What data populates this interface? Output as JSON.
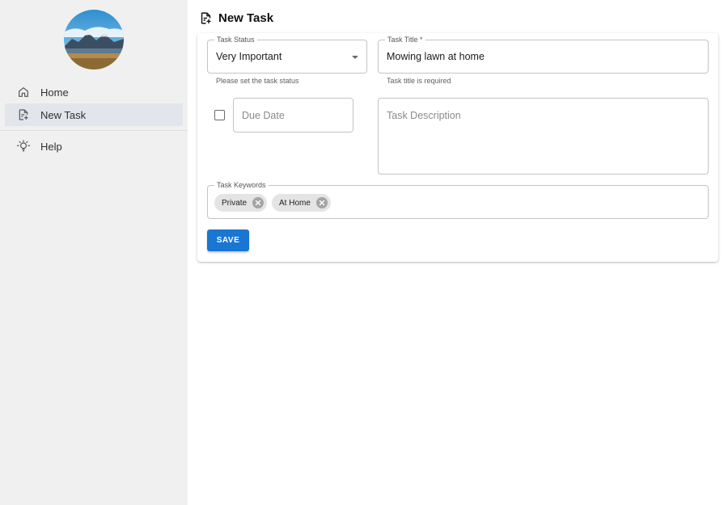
{
  "sidebar": {
    "items": [
      {
        "label": "Home",
        "icon": "home-icon"
      },
      {
        "label": "New Task",
        "icon": "note-add-icon",
        "active": true
      },
      {
        "label": "Help",
        "icon": "lightbulb-icon"
      }
    ]
  },
  "header": {
    "title": "New Task",
    "icon": "note-add-icon"
  },
  "form": {
    "status": {
      "label": "Task Status",
      "value": "Very Important",
      "helper": "Please set the task status"
    },
    "title": {
      "label": "Task Title *",
      "value": "Mowing lawn at home",
      "helper": "Task title is required"
    },
    "due_date": {
      "placeholder": "Due Date",
      "checked": false
    },
    "description": {
      "placeholder": "Task Description"
    },
    "keywords": {
      "label": "Task Keywords",
      "chips": [
        "Private",
        "At Home"
      ]
    },
    "save_label": "SAVE"
  },
  "colors": {
    "primary": "#1976d2",
    "sidebar_bg": "#f0f0f0",
    "active_item_bg": "#e2e6ec"
  }
}
